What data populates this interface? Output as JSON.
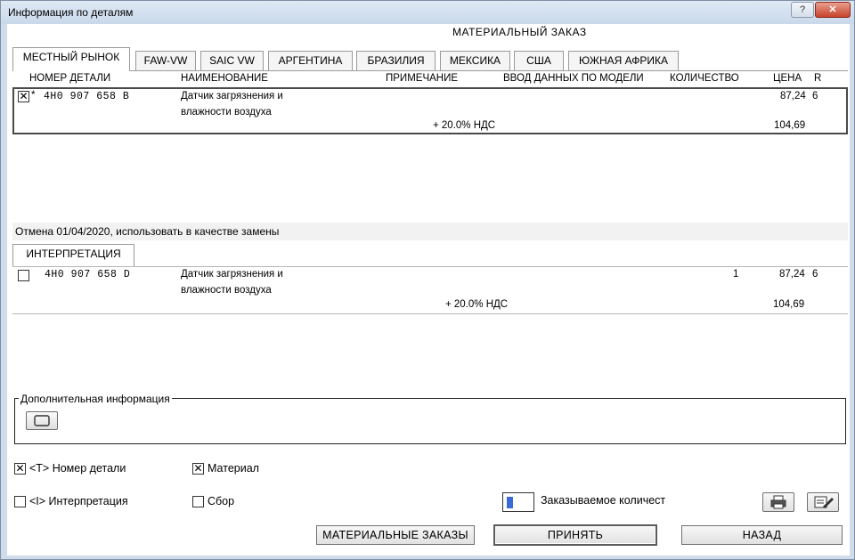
{
  "window": {
    "title": "Информация по деталям",
    "help_label": "?",
    "close_label": "✕"
  },
  "header": {
    "title": "МАТЕРИАЛЬНЫЙ ЗАКАЗ"
  },
  "market_tabs": [
    "МЕСТНЫЙ РЫНОК",
    "FAW-VW",
    "SAIC VW",
    "АРГЕНТИНА",
    "БРАЗИЛИЯ",
    "МЕКСИКА",
    "США",
    "ЮЖНАЯ АФРИКА"
  ],
  "columns": {
    "part_number": "НОМЕР ДЕТАЛИ",
    "name": "НАИМЕНОВАНИЕ",
    "note": "ПРИМЕЧАНИЕ",
    "model_input": "ВВОД ДАННЫХ ПО МОДЕЛИ",
    "quantity": "КОЛИЧЕСТВО",
    "price": "ЦЕНА",
    "r": "R"
  },
  "main_row": {
    "checked": true,
    "marker": "*",
    "part_number": "4H0  907  658  B",
    "name_line1": "Датчик загрязнения и",
    "name_line2": "влажности воздуха",
    "price": "87,24",
    "r": "6",
    "vat_label": "+ 20.0% НДС",
    "price_with_vat": "104,69"
  },
  "replacement_notice": "Отмена 01/04/2020, использовать в качестве замены",
  "interpretation_tab": "ИНТЕРПРЕТАЦИЯ",
  "replacement_row": {
    "checked": false,
    "part_number": "4H0  907  658  D",
    "name_line1": "Датчик загрязнения и",
    "name_line2": "влажности воздуха",
    "quantity": "1",
    "price": "87,24",
    "r": "6",
    "vat_label": "+ 20.0% НДС",
    "price_with_vat": "104,69"
  },
  "additional_info": {
    "legend": "Дополнительная информация"
  },
  "options": {
    "part_number": {
      "label": "<T> Номер детали",
      "checked": true
    },
    "material": {
      "label": "Материал",
      "checked": true
    },
    "interpretation": {
      "label": "<I> Интерпретация",
      "checked": false
    },
    "assembly": {
      "label": "Сбор",
      "checked": false
    }
  },
  "order_qty": {
    "label": "Заказываемое количест",
    "value": ""
  },
  "buttons": {
    "material_orders": "МАТЕРИАЛЬНЫЕ ЗАКАЗЫ",
    "accept": "ПРИНЯТЬ",
    "back": "НАЗАД"
  },
  "icons": {
    "print": "printer-icon",
    "edit": "edit-icon"
  }
}
